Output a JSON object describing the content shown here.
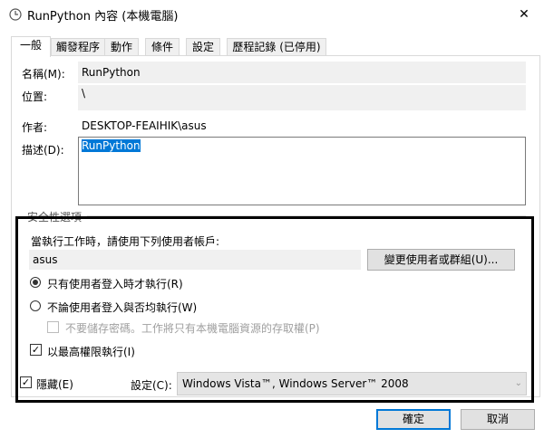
{
  "window": {
    "title": "RunPython 內容 (本機電腦)",
    "close_glyph": "✕"
  },
  "tabs": [
    {
      "label": "一般",
      "active": true
    },
    {
      "label": "觸發程序"
    },
    {
      "label": "動作"
    },
    {
      "label": "條件"
    },
    {
      "label": "設定"
    },
    {
      "label": "歷程記錄 (已停用)"
    }
  ],
  "general": {
    "name_label": "名稱(M):",
    "name_value": "RunPython",
    "location_label": "位置:",
    "location_value": "\\",
    "author_label": "作者:",
    "author_value": "DESKTOP-FEAIHIK\\asus",
    "description_label": "描述(D):",
    "description_value": "RunPython"
  },
  "security": {
    "group_label": "安全性選項",
    "run_as_label": "當執行工作時，請使用下列使用者帳戶:",
    "user_account": "asus",
    "change_user_button": "變更使用者或群組(U)...",
    "radio_logged_on": "只有使用者登入時才執行(R)",
    "radio_whether": "不論使用者登入與否均執行(W)",
    "no_store_password": "不要儲存密碼。工作將只有本機電腦資源的存取權(P)",
    "highest_privileges": "以最高權限執行(I)"
  },
  "bottom": {
    "hidden_label": "隱藏(E)",
    "configure_label": "設定(C):",
    "configure_value": "Windows Vista™, Windows Server™ 2008"
  },
  "buttons": {
    "ok": "確定",
    "cancel": "取消"
  },
  "colors": {
    "selection": "#0078d7",
    "highlight_border": "#000000"
  }
}
